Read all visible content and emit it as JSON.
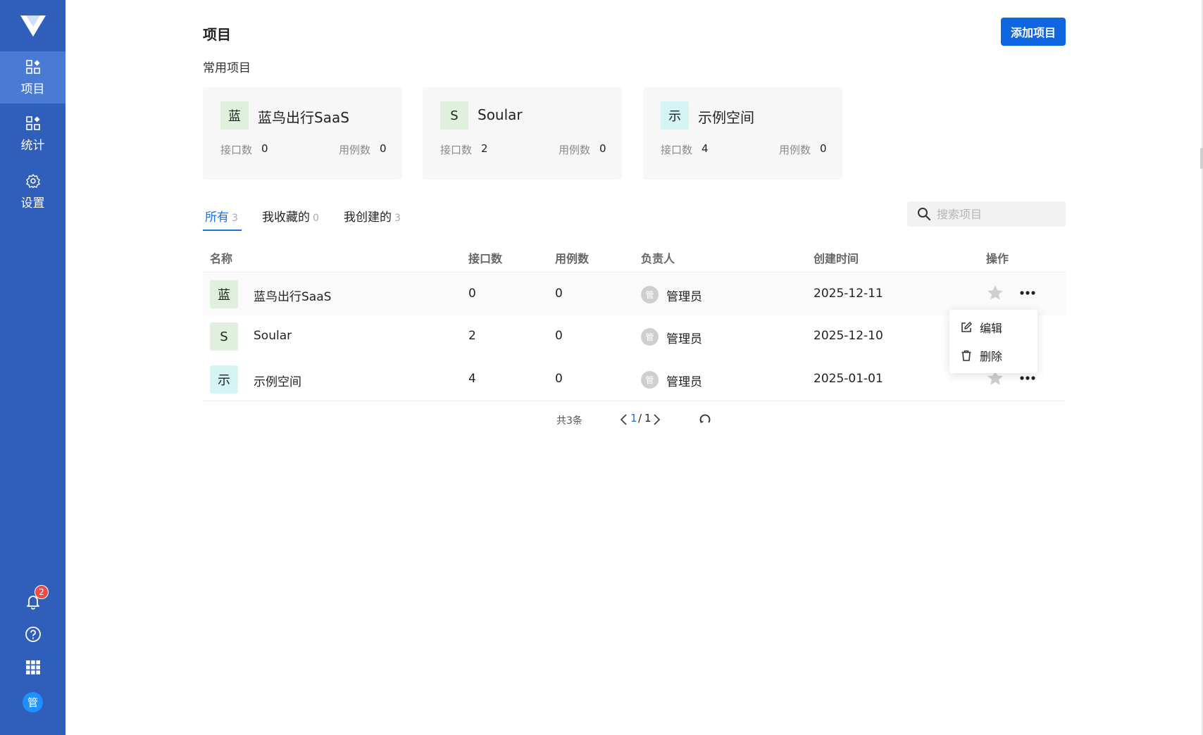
{
  "sidebar": {
    "items": [
      {
        "label": "项目",
        "icon": "apps-icon",
        "active": true
      },
      {
        "label": "统计",
        "icon": "apps-icon",
        "active": false
      },
      {
        "label": "设置",
        "icon": "gear-icon",
        "active": false
      }
    ],
    "notification_count": "2",
    "user_avatar": "管",
    "bottom_icons": [
      "bell-icon",
      "help-icon",
      "grid-icon"
    ]
  },
  "header": {
    "title": "项目",
    "add_button": "添加项目"
  },
  "frequent": {
    "title": "常用项目",
    "cards": [
      {
        "badge": "蓝",
        "name": "蓝鸟出行SaaS",
        "api_label": "接口数",
        "api_count": "0",
        "case_label": "用例数",
        "case_count": "0",
        "color": "#dff0dc"
      },
      {
        "badge": "S",
        "name": "Soular",
        "api_label": "接口数",
        "api_count": "2",
        "case_label": "用例数",
        "case_count": "0",
        "color": "#dff0dc"
      },
      {
        "badge": "示",
        "name": "示例空间",
        "api_label": "接口数",
        "api_count": "4",
        "case_label": "用例数",
        "case_count": "0",
        "color": "#d5f4f4"
      }
    ]
  },
  "tabs": [
    {
      "label": "所有",
      "count": "3",
      "active": true
    },
    {
      "label": "我收藏的",
      "count": "0",
      "active": false
    },
    {
      "label": "我创建的",
      "count": "3",
      "active": false
    }
  ],
  "search": {
    "placeholder": "搜索项目"
  },
  "table": {
    "columns": [
      "名称",
      "接口数",
      "用例数",
      "负责人",
      "创建时间",
      "操作"
    ],
    "rows": [
      {
        "badge": "蓝",
        "name": "蓝鸟出行SaaS",
        "api": "0",
        "cases": "0",
        "owner_avatar": "管",
        "owner": "管理员",
        "created": "2025-12-11"
      },
      {
        "badge": "S",
        "name": "Soular",
        "api": "2",
        "cases": "0",
        "owner_avatar": "管",
        "owner": "管理员",
        "created": "2025-12-10"
      },
      {
        "badge": "示",
        "name": "示例空间",
        "api": "4",
        "cases": "0",
        "owner_avatar": "管",
        "owner": "管理员",
        "created": "2025-01-01"
      }
    ]
  },
  "pagination": {
    "total": "共3条",
    "current": "1",
    "separator": "/",
    "pages": "1"
  },
  "row_menu": {
    "edit": "编辑",
    "delete": "删除"
  },
  "colors": {
    "sidebar": "#2f5fbb",
    "accent": "#0e66e0",
    "green_badge": "#dff0dc",
    "cyan_badge": "#d5f4f4"
  }
}
